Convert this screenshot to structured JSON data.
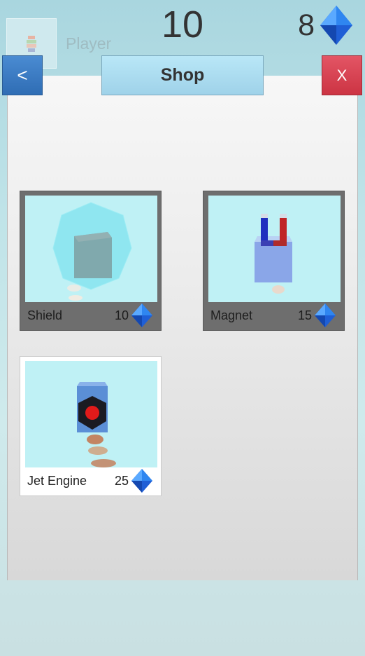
{
  "hud": {
    "player_name": "Player",
    "score": "10",
    "gem_count": "8",
    "gem_icon": "blue-diamond-icon"
  },
  "header": {
    "back_label": "<",
    "title": "Shop",
    "close_label": "X"
  },
  "items": [
    {
      "name": "Shield",
      "price": "10",
      "state": "owned",
      "icon": "shield-icon"
    },
    {
      "name": "Magnet",
      "price": "15",
      "state": "owned",
      "icon": "magnet-icon"
    },
    {
      "name": "Jet Engine",
      "price": "25",
      "state": "available",
      "icon": "jet-engine-icon"
    }
  ],
  "colors": {
    "back_button": "#3a7cc4",
    "close_button": "#d94050",
    "title_button": "#aadcf0",
    "gem": "#1f5fd6"
  }
}
